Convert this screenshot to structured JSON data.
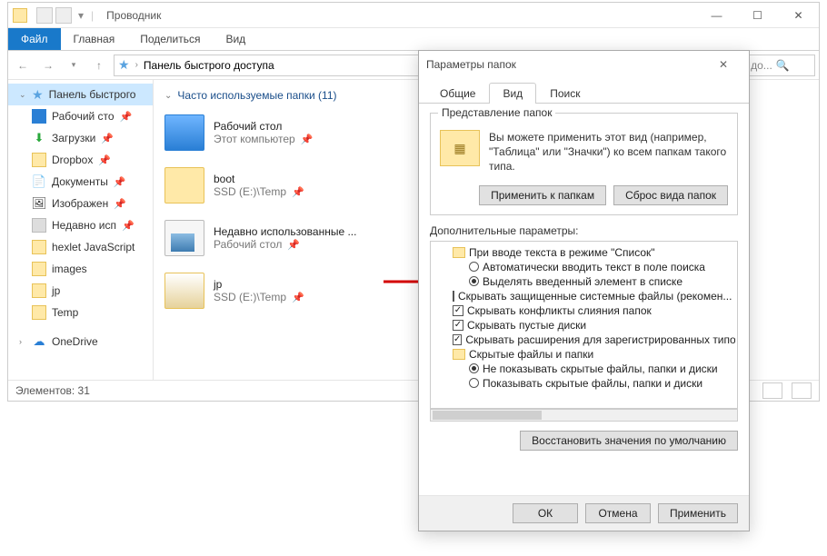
{
  "window": {
    "title": "Проводник"
  },
  "ribbon": {
    "file": "Файл",
    "tabs": [
      "Главная",
      "Поделиться",
      "Вид"
    ]
  },
  "address": {
    "path": "Панель быстрого доступа",
    "search_hint": "го до..."
  },
  "nav": [
    {
      "label": "Панель быстрого",
      "icon": "star",
      "selected": true
    },
    {
      "label": "Рабочий сто",
      "icon": "desktop",
      "pinned": true
    },
    {
      "label": "Загрузки",
      "icon": "download",
      "pinned": true
    },
    {
      "label": "Dropbox",
      "icon": "dropbox",
      "pinned": true
    },
    {
      "label": "Документы",
      "icon": "doc",
      "pinned": true
    },
    {
      "label": "Изображен",
      "icon": "img",
      "pinned": true
    },
    {
      "label": "Недавно исп",
      "icon": "recent",
      "pinned": true
    },
    {
      "label": "hexlet JavaScript",
      "icon": "folder"
    },
    {
      "label": "images",
      "icon": "folder"
    },
    {
      "label": "jp",
      "icon": "folder"
    },
    {
      "label": "Temp",
      "icon": "folder"
    },
    {
      "label": "OneDrive",
      "icon": "onedrive",
      "caret": true
    }
  ],
  "group": {
    "title": "Часто используемые папки (11)"
  },
  "items": [
    {
      "name": "Рабочий стол",
      "sub": "Этот компьютер",
      "ico": "desk"
    },
    {
      "name": "boot",
      "sub": "SSD (E:)\\Temp",
      "ico": "folder"
    },
    {
      "name": "Недавно использованные ...",
      "sub": "Рабочий стол",
      "ico": "recent"
    },
    {
      "name": "jp",
      "sub": "SSD (E:)\\Temp",
      "ico": "jp"
    }
  ],
  "status": {
    "count_label": "Элементов: 31"
  },
  "dialog": {
    "title": "Параметры папок",
    "tabs": {
      "general": "Общие",
      "view": "Вид",
      "search": "Поиск"
    },
    "rep": {
      "legend": "Представление папок",
      "text": "Вы можете применить этот вид (например, \"Таблица\" или \"Значки\") ко всем папкам такого типа.",
      "apply": "Применить к папкам",
      "reset": "Сброс вида папок"
    },
    "adv": {
      "label": "Дополнительные параметры:",
      "n0": "При вводе текста в режиме \"Список\"",
      "n1": "Автоматически вводить текст в поле поиска",
      "n2": "Выделять введенный элемент в списке",
      "n3": "Скрывать защищенные системные файлы (рекомен...",
      "n4": "Скрывать конфликты слияния папок",
      "n5": "Скрывать пустые диски",
      "n6": "Скрывать расширения для зарегистрированных типо",
      "n7": "Скрытые файлы и папки",
      "n8": "Не показывать скрытые файлы, папки и диски",
      "n9": "Показывать скрытые файлы, папки и диски",
      "restore": "Восстановить значения по умолчанию"
    },
    "buttons": {
      "ok": "ОК",
      "cancel": "Отмена",
      "apply": "Применить"
    }
  }
}
